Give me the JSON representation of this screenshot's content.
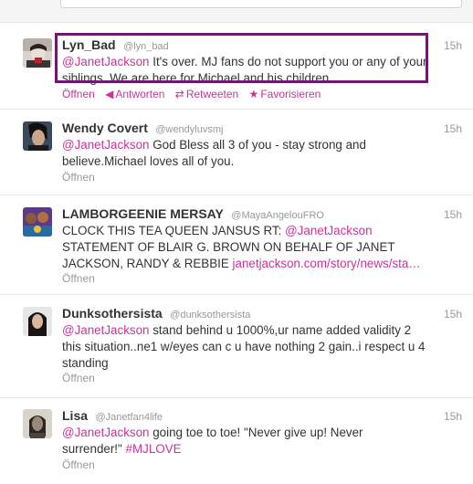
{
  "colors": {
    "accent": "#cc3399",
    "highlight_box": "#6b1a6e"
  },
  "tweets": [
    {
      "name": "Lyn_Bad",
      "handle": "@lyn_bad",
      "time": "15h",
      "mention": "@JanetJackson",
      "text": "It's over. MJ fans do not support you or any of your siblings. We are here for Michael and his children.",
      "actions": {
        "open": "Öffnen",
        "reply": "Antworten",
        "retweet": "Retweeten",
        "favorite": "Favorisieren"
      }
    },
    {
      "name": "Wendy Covert",
      "handle": "@wendyluvsmj",
      "time": "15h",
      "mention": "@JanetJackson",
      "text": "God Bless all 3 of you - stay strong and believe.Michael loves all of you.",
      "open": "Öffnen"
    },
    {
      "name": "LAMBORGEENIE MERSAY",
      "handle": "@MayaAngelouFRO",
      "time": "15h",
      "text_before": "CLOCK THIS TEA QUEEN JANSUS RT:",
      "mention": "@JanetJackson",
      "text_after": "STATEMENT OF BLAIR G. BROWN ON BEHALF OF JANET JACKSON, RANDY & REBBIE",
      "link": "janetjackson.com/story/news/sta…",
      "open": "Öffnen"
    },
    {
      "name": "Dunksothersista",
      "handle": "@dunksothersista",
      "time": "15h",
      "mention": "@JanetJackson",
      "text": "stand behind u 1000%,ur name added validity 2 this situation..ne1 w/eyes can c u have nothing 2 gain..i respect u 4 standing",
      "open": "Öffnen"
    },
    {
      "name": "Lisa",
      "handle": "@Janetfan4life",
      "time": "15h",
      "mention": "@JanetJackson",
      "text": "going toe to toe! \"Never give up! Never surrender!\"",
      "hashtag": "#MJLOVE",
      "open": "Öffnen"
    }
  ]
}
